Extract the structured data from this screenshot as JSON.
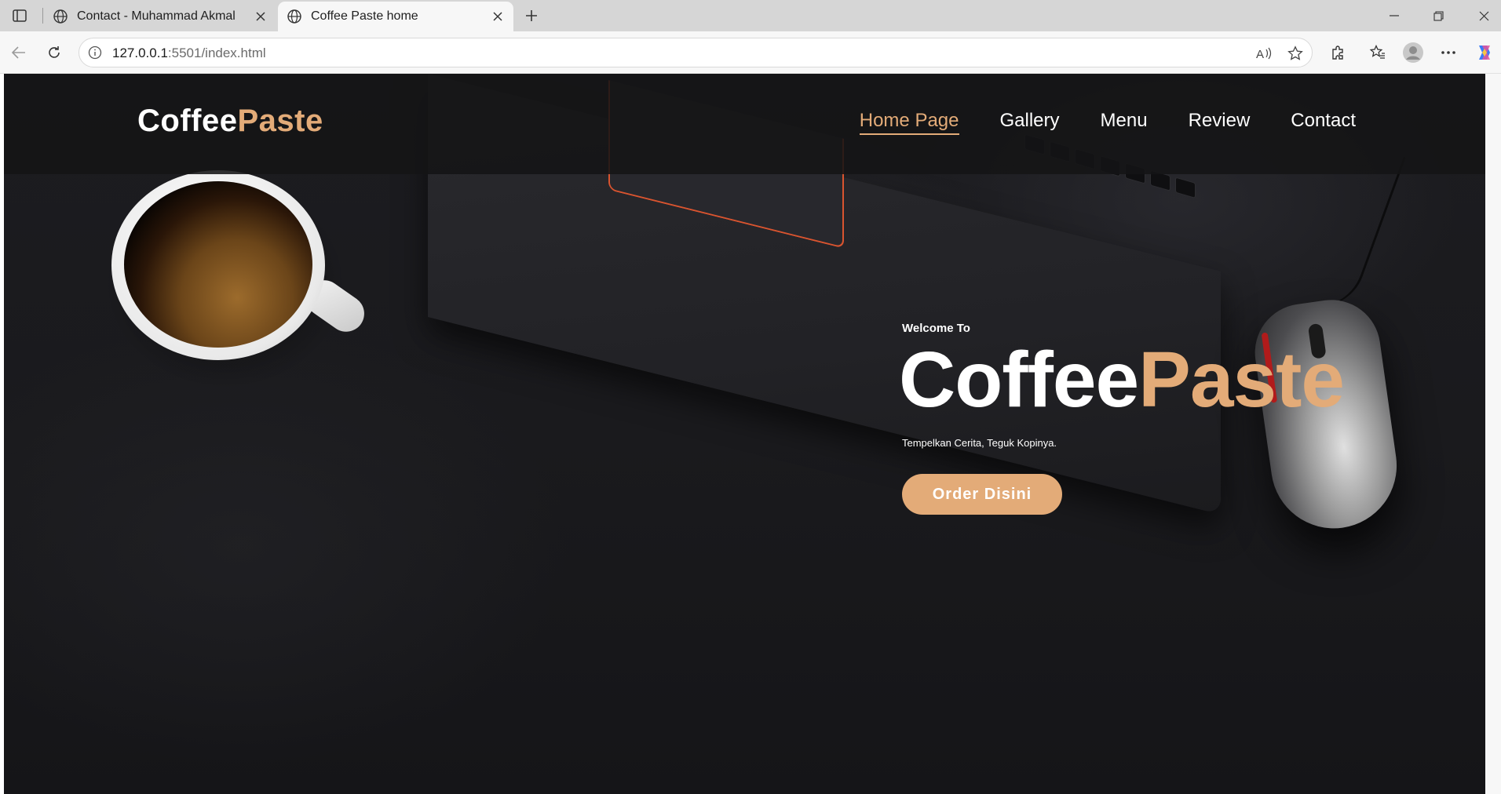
{
  "browser": {
    "tabs": [
      {
        "title": "Contact - Muhammad Akmal"
      },
      {
        "title": "Coffee Paste home"
      }
    ],
    "address": {
      "url_host": "127.0.0.1",
      "url_rest": ":5501/index.html"
    },
    "icons": {
      "sidebar": "tab-sidebar-icon",
      "globe": "globe-icon",
      "close": "close-icon",
      "new_tab": "plus-icon",
      "back": "back-arrow-icon",
      "reload": "reload-icon",
      "info": "info-icon",
      "read_aloud": "read-aloud-icon",
      "favorite": "star-icon",
      "extensions": "puzzle-icon",
      "favorites": "favorites-icon",
      "profile": "profile-icon",
      "more": "more-icon",
      "copilot": "copilot-icon"
    }
  },
  "site": {
    "logo": {
      "part1": "Coffee",
      "part2": "Paste"
    },
    "nav": [
      {
        "label": "Home Page",
        "active": true
      },
      {
        "label": "Gallery",
        "active": false
      },
      {
        "label": "Menu",
        "active": false
      },
      {
        "label": "Review",
        "active": false
      },
      {
        "label": "Contact",
        "active": false
      }
    ],
    "hero": {
      "welcome": "Welcome To",
      "title_part1": "Coffee",
      "title_part2": "Paste",
      "tagline": "Tempelkan Cerita, Teguk Kopinya.",
      "button": "Order Disini"
    },
    "colors": {
      "accent": "#e3ab78",
      "header_bg": "#141416",
      "text": "#ffffff"
    }
  }
}
